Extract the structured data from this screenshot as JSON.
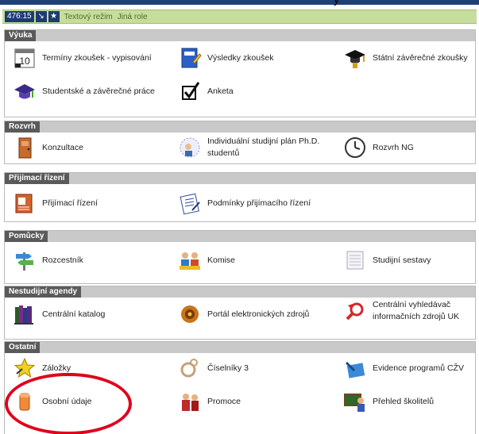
{
  "topbar": {
    "partial_text": "y"
  },
  "statusbar": {
    "counter": "476:15",
    "text_mode": "Textový režim",
    "other_role": "Jiná role"
  },
  "sections": {
    "vyuka": {
      "title": "Výuka",
      "items": [
        "Termíny zkoušek - vypisování",
        "Výsledky zkoušek",
        "Státní závěrečné zkoušky",
        "Studentské a závěrečné práce",
        "Anketa"
      ]
    },
    "rozvrh": {
      "title": "Rozvrh",
      "items": [
        "Konzultace",
        "Individuální studijní plán Ph.D. studentů",
        "Rozvrh NG"
      ]
    },
    "prijimaci": {
      "title": "Přijímací řízení",
      "items": [
        "Přijímací řízení",
        "Podmínky přijímacího řízení"
      ]
    },
    "pomucky": {
      "title": "Pomůcky",
      "items": [
        "Rozcestník",
        "Komise",
        "Studijní sestavy"
      ]
    },
    "nestudijni": {
      "title": "Nestudijní agendy",
      "items": [
        "Centrální katalog",
        "Portál elektronických zdrojů",
        "Centrální vyhledávač informačních zdrojů UK"
      ]
    },
    "ostatni": {
      "title": "Ostatní",
      "items": [
        "Záložky",
        "Číselníky 3",
        "Evidence programů CŽV",
        "Osobní údaje",
        "Promoce",
        "Přehled školitelů"
      ]
    }
  },
  "colors": {
    "header_dark": "#5a5a5a",
    "header_light": "#c9c9c9",
    "statusbar": "#c6dd9c",
    "highlight": "#e0001b"
  }
}
